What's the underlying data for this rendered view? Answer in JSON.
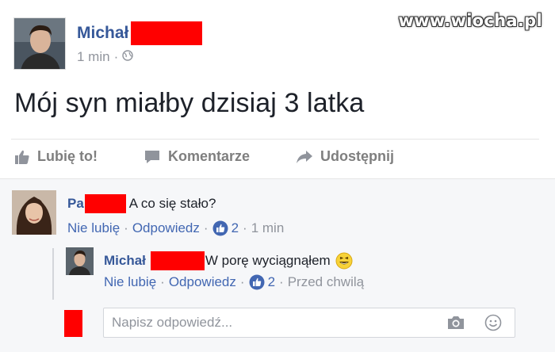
{
  "watermark": "www.wiocha.pl",
  "post": {
    "author_name": "Michał",
    "time": "1 min",
    "meta_separator": "·",
    "text": "Mój syn miałby dzisiaj 3 latka",
    "redaction_color": "#ff0000"
  },
  "actions": {
    "like": "Lubię to!",
    "comment": "Komentarze",
    "share": "Udostępnij"
  },
  "comment1": {
    "author_prefix": "Pa",
    "text": "A co się stało?",
    "unlike": "Nie lubię",
    "reply": "Odpowiedz",
    "likes": "2",
    "time": "1 min"
  },
  "comment2": {
    "author_name": "Michał",
    "text": "W porę wyciągnąłem",
    "unlike": "Nie lubię",
    "reply": "Odpowiedz",
    "likes": "2",
    "time": "Przed chwilą"
  },
  "reply_box": {
    "placeholder": "Napisz odpowiedź..."
  },
  "colors": {
    "link_blue": "#365899",
    "action_blue": "#4267b2",
    "meta_grey": "#90949c",
    "comments_bg": "#f6f7f9"
  },
  "icons": {
    "globe": "globe-icon",
    "thumbs_up": "thumbs-up-icon",
    "comment": "comment-icon",
    "share": "share-arrow-icon",
    "like_reaction": "like-reaction-icon",
    "laugh_emoji": "laughing-emoji-icon",
    "camera": "camera-icon",
    "emoji": "emoji-icon"
  }
}
